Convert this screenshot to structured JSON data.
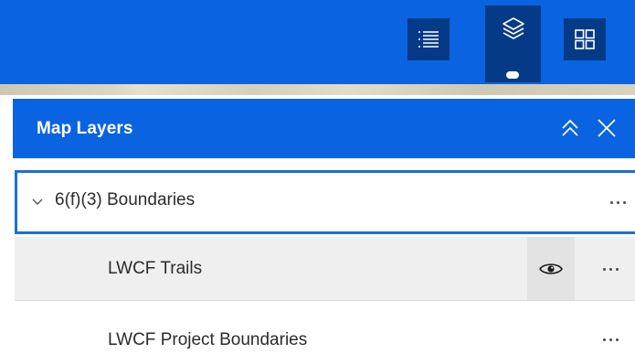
{
  "toolbar": {
    "buttons": [
      {
        "icon": "legend-list-icon",
        "active": false
      },
      {
        "icon": "layers-icon",
        "active": true
      },
      {
        "icon": "basemap-grid-icon",
        "active": false
      }
    ],
    "accent_color": "#0a63e0",
    "button_color": "#043a86"
  },
  "panel": {
    "title": "Map Layers",
    "actions": [
      "collapse-icon",
      "close-icon"
    ]
  },
  "layers": {
    "group": {
      "label": "6(f)(3) Boundaries",
      "expanded": true,
      "selected": true
    },
    "children": [
      {
        "label": "LWCF Trails",
        "visible": true,
        "hovered": true
      },
      {
        "label": "LWCF Project Boundaries",
        "visible": true,
        "hovered": false
      }
    ]
  }
}
